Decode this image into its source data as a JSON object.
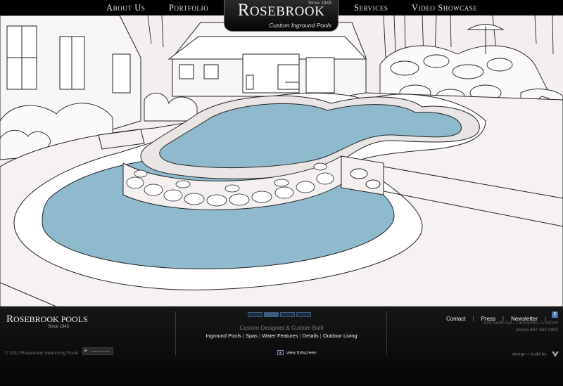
{
  "nav": {
    "about": "About Us",
    "portfolio": "Portfolio",
    "services": "Services",
    "video": "Video Showcase"
  },
  "logo": {
    "since": "Since 1943",
    "initial": "R",
    "rest": "OSEBROOK",
    "tagline": "Custom Inground Pools"
  },
  "footer": {
    "logo_initial": "R",
    "logo_rest": "OSEBROOK POOLS",
    "logo_since": "Since 1943",
    "copyright": "© 2012 Rosebrook Swimming Pools",
    "tagline": "Custom Designed & Custom Built",
    "services": [
      "Inground Pools",
      "Spas",
      "Water Features",
      "Details",
      "Outdoor Living"
    ],
    "view_fullscreen": "view fullscreen",
    "links": [
      "Contact",
      "Press",
      "Newsletter"
    ],
    "address": "543 North Ave., Libertyville, IL 60048",
    "phone": "phone  847.362.0400",
    "credit": "design + build by"
  },
  "icons": {
    "facebook": "facebook-icon",
    "fullscreen": "fullscreen-icon",
    "player": "audio-player-icon"
  },
  "colors": {
    "pool_water": "#8fb9cd",
    "footer_bg": "#0b0b0b",
    "slide_active": "#3e5e80"
  }
}
